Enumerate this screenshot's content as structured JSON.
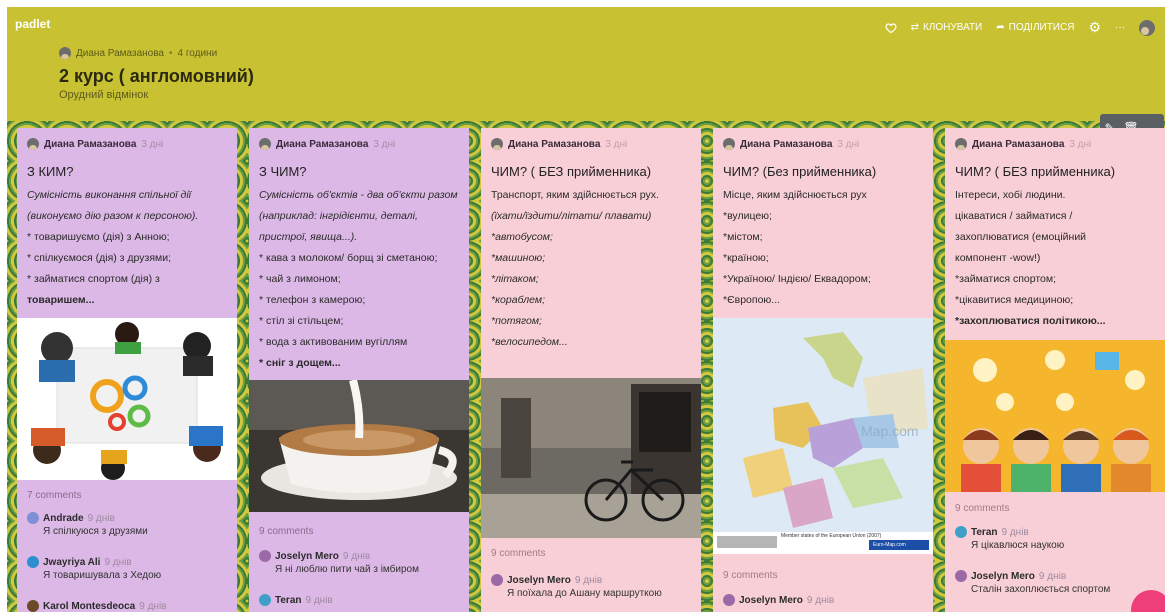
{
  "app": {
    "logo": "padlet",
    "author": "Диана Рамазанова",
    "author_time": "4 години",
    "title": "2 курс ( англомовний)",
    "subtitle": "Орудний відмінок",
    "actions": {
      "clone": "КЛОНУВАТИ",
      "share": "ПОДІЛИТИСЯ"
    }
  },
  "cards": [
    {
      "author": "Диана Рамазанова",
      "time": "3 дні",
      "title": "З КИМ?",
      "lines": [
        "Сумісність виконання спільної дії",
        "(виконуємо дію разом к персоною).",
        "* товаришуємо (дія)  з Анною;",
        "* спілкуємося (дія) з друзями;",
        "* займатися спортом (дія) з",
        "товаришем..."
      ],
      "comments_count": "7 comments",
      "comments": [
        {
          "name": "Andrade",
          "time": "9 днів",
          "text": "Я спілкуюся з друзями"
        },
        {
          "name": "Jwayriya Ali",
          "time": "9 днів",
          "text": "Я товаришувала з Хедою"
        },
        {
          "name": "Karol Montesdeoca",
          "time": "9 днів",
          "text": ""
        }
      ]
    },
    {
      "author": "Диана Рамазанова",
      "time": "3 дні",
      "title": "З ЧИМ?",
      "lines": [
        "Сумісність об'єктів - два об'єкти разом",
        "(наприклад: інгрідієнти, деталі,",
        "пристрої, явища...).",
        "* кава з молоком/ борщ зі сметаною;",
        "* чай з лимоном;",
        "* телефон з камерою;",
        "* стіл зі стільцем;",
        "* вода з активованим вугіллям",
        "* сніг з дощем..."
      ],
      "comments_count": "9 comments",
      "comments": [
        {
          "name": "Joselyn Mero",
          "time": "9 днів",
          "text": "Я ні люблю пити чай з імбиром"
        },
        {
          "name": "Teran",
          "time": "9 днів",
          "text": ""
        }
      ]
    },
    {
      "author": "Диана Рамазанова",
      "time": "3 дні",
      "title": "ЧИМ? ( БЕЗ прийменника)",
      "lines": [
        "Транспорт, яким здійснюється  рух.",
        "(їхати/їздити/літати/ плавати)",
        "*автобусом;",
        "*машиною;",
        "*літаком;",
        "*кораблем;",
        "*потягом;",
        "*велосипедом..."
      ],
      "comments_count": "9 comments",
      "comments": [
        {
          "name": "Joselyn Mero",
          "time": "9 днів",
          "text": "Я поїхала до Ашану маршруткою"
        }
      ]
    },
    {
      "author": "Диана Рамазанова",
      "time": "3 дні",
      "title": "ЧИМ? (Без прийменника)",
      "lines": [
        "Місце, яким здійснюється рух",
        "*вулицею;",
        "*містом;",
        "*країною;",
        "*Україною/ Індією/ Еквадором;",
        "*Європою..."
      ],
      "map_caption": "Member states of the European Union (2007)",
      "map_brand": "Euro-Map.com",
      "comments_count": "9 comments",
      "comments": [
        {
          "name": "Joselyn Mero",
          "time": "9 днів",
          "text": ""
        }
      ]
    },
    {
      "author": "Диана Рамазанова",
      "time": "3 дні",
      "title": "ЧИМ? ( БЕЗ прийменника)",
      "lines": [
        "Інтереси, хобі людини.",
        "цікаватися / займатися /",
        "захоплюватися (емоційний",
        "компонент -wow!)",
        "*займатися спортом;",
        "*цікавитися медициною;",
        "*захоплюватися  політикою..."
      ],
      "comments_count": "9 comments",
      "comments": [
        {
          "name": "Teran",
          "time": "9 днів",
          "text": "Я цікавлюся наукою"
        },
        {
          "name": "Joselyn Mero",
          "time": "9 днів",
          "text": "Сталін захоплюється спортом"
        }
      ]
    }
  ]
}
